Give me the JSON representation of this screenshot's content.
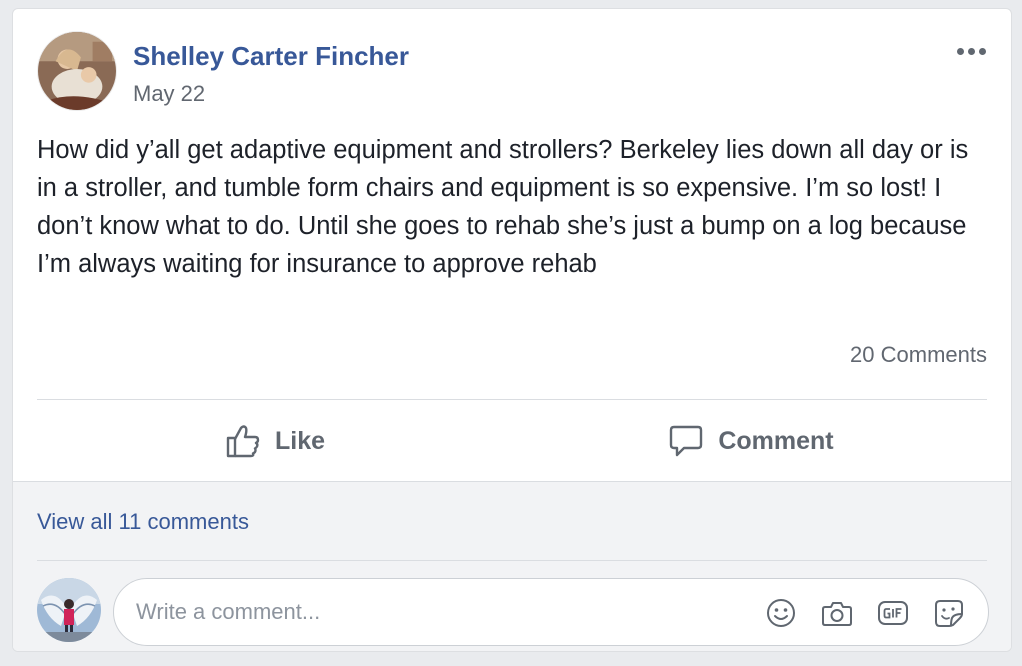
{
  "post": {
    "author": "Shelley Carter Fincher",
    "date": "May 22",
    "text": "How did y’all get adaptive equipment and strollers? Berkeley lies down all day or is in a stroller, and tumble form chairs and equipment is so expensive. I’m so lost! I don’t know what to do. Until she goes to rehab she’s just a bump on a log because I’m always waiting for insurance to approve rehab",
    "comment_count": "20 Comments"
  },
  "actions": {
    "like_label": "Like",
    "comment_label": "Comment"
  },
  "comments": {
    "view_all": "View all 11 comments",
    "input_placeholder": "Write a comment...",
    "input_value": ""
  },
  "icons": {
    "more": "more-options-icon",
    "like": "thumbs-up-icon",
    "comment": "speech-bubble-icon",
    "emoji": "smiley-icon",
    "camera": "camera-icon",
    "gif": "gif-icon",
    "sticker": "sticker-icon"
  },
  "colors": {
    "link_blue": "#385898",
    "secondary_text": "#616770",
    "action_gray": "#606770",
    "background": "#e9ebee"
  }
}
